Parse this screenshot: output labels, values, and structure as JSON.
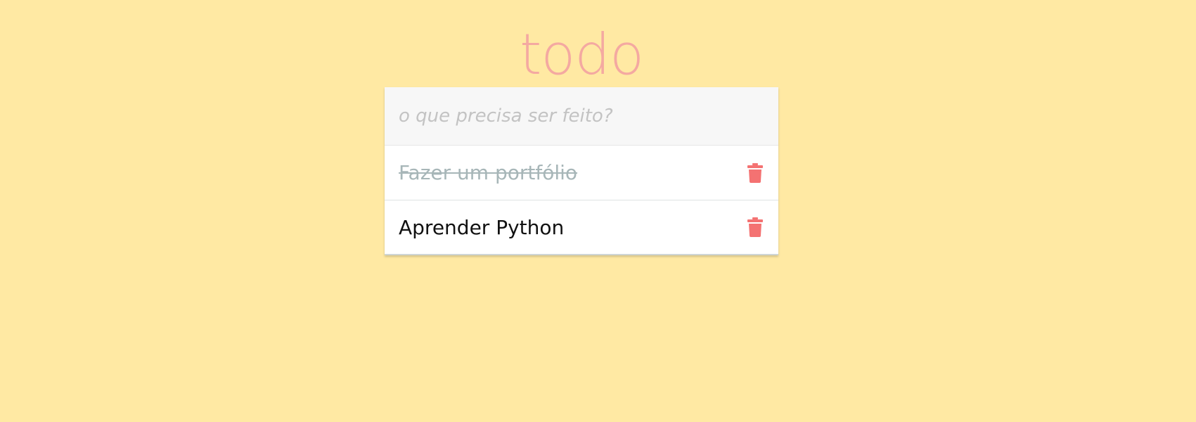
{
  "app": {
    "title": "todo",
    "accent_color": "#f4a9a1",
    "background_color": "#ffe9a3"
  },
  "input": {
    "placeholder": "o que precisa ser feito?",
    "value": ""
  },
  "items": [
    {
      "label": "Fazer um portfólio",
      "completed": true,
      "delete_icon": "trash-icon"
    },
    {
      "label": "Aprender Python",
      "completed": false,
      "delete_icon": "trash-icon"
    }
  ],
  "colors": {
    "trash": "#f47272",
    "completed_text": "#a7b6b8",
    "active_text": "#111111"
  }
}
